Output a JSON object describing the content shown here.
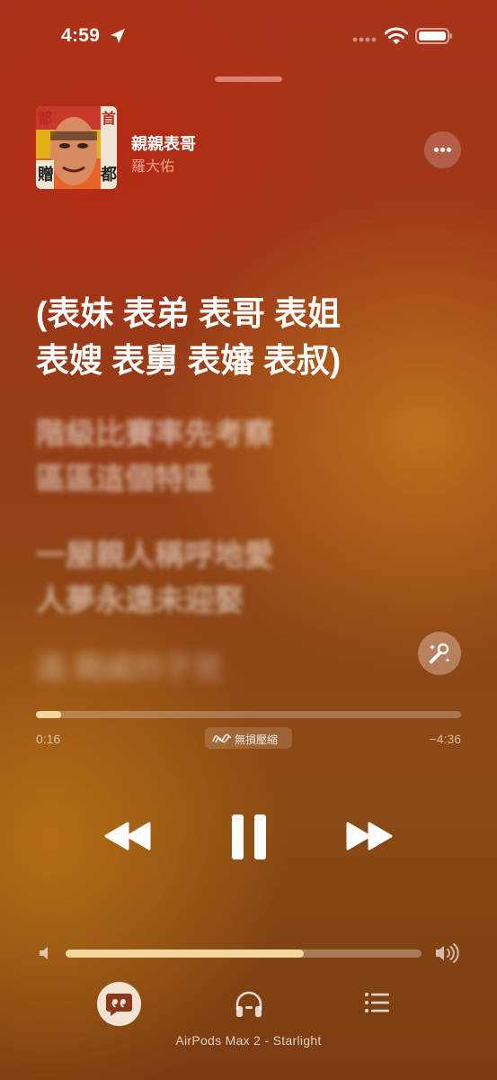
{
  "status_bar": {
    "time": "4:59",
    "icons": [
      "location-arrow-icon",
      "cellular-signal-icon",
      "wifi-icon",
      "battery-icon"
    ]
  },
  "now_playing": {
    "title": "親親表哥",
    "artist": "羅大佑",
    "artwork_text": [
      "首",
      "都",
      "贈",
      "都"
    ]
  },
  "lyrics": {
    "active": [
      "(表妹 表弟 表哥 表姐",
      "表嫂 表舅 表嬸 表叔)"
    ],
    "upcoming": [
      "階級比賽率先考察",
      "區區這個特區",
      "一屋親人稱呼地愛",
      "人夢永遠未迎娶",
      "過 親戚的子兒"
    ]
  },
  "playback": {
    "elapsed": "0:16",
    "remaining": "−4:36",
    "progress": 0.06,
    "quality_label": "無損壓縮",
    "volume": 0.67
  },
  "output_device": "AirPods Max 2 - Starlight",
  "colors": {
    "accent_fill": "#f4d8a0",
    "artist_text": "#f0a08a",
    "background_top": "#a8341a",
    "background_bottom": "#7a3c12"
  }
}
